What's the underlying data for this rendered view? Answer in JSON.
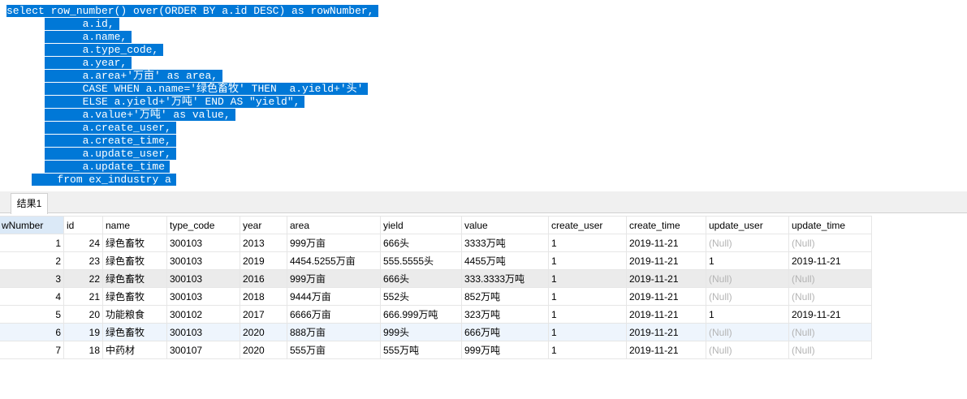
{
  "sql": [
    "select row_number() over(ORDER BY a.id DESC) as rowNumber,",
    "      a.id,",
    "      a.name,",
    "      a.type_code,",
    "      a.year,",
    "      a.area+'万亩' as area,",
    "      CASE WHEN a.name='绿色畜牧' THEN  a.yield+'头'",
    "      ELSE a.yield+'万吨' END AS \"yield\",",
    "      a.value+'万吨' as value,",
    "      a.create_user,",
    "      a.create_time,",
    "      a.update_user,",
    "      a.update_time",
    "    from ex_industry a"
  ],
  "tab": "结果1",
  "columns": [
    "wNumber",
    "id",
    "name",
    "type_code",
    "year",
    "area",
    "yield",
    "value",
    "create_user",
    "create_time",
    "update_user",
    "update_time"
  ],
  "rows": [
    [
      "1",
      "24",
      "绿色畜牧",
      "300103",
      "2013",
      "999万亩",
      "666头",
      "3333万吨",
      "1",
      "2019-11-21",
      "(Null)",
      "(Null)"
    ],
    [
      "2",
      "23",
      "绿色畜牧",
      "300103",
      "2019",
      "4454.5255万亩",
      "555.5555头",
      "4455万吨",
      "1",
      "2019-11-21",
      "1",
      "2019-11-21"
    ],
    [
      "3",
      "22",
      "绿色畜牧",
      "300103",
      "2016",
      "999万亩",
      "666头",
      "333.3333万吨",
      "1",
      "2019-11-21",
      "(Null)",
      "(Null)"
    ],
    [
      "4",
      "21",
      "绿色畜牧",
      "300103",
      "2018",
      "9444万亩",
      "552头",
      "852万吨",
      "1",
      "2019-11-21",
      "(Null)",
      "(Null)"
    ],
    [
      "5",
      "20",
      "功能粮食",
      "300102",
      "2017",
      "6666万亩",
      "666.999万吨",
      "323万吨",
      "1",
      "2019-11-21",
      "1",
      "2019-11-21"
    ],
    [
      "6",
      "19",
      "绿色畜牧",
      "300103",
      "2020",
      "888万亩",
      "999头",
      "666万吨",
      "1",
      "2019-11-21",
      "(Null)",
      "(Null)"
    ],
    [
      "7",
      "18",
      "中药材",
      "300107",
      "2020",
      "555万亩",
      "555万吨",
      "999万吨",
      "1",
      "2019-11-21",
      "(Null)",
      "(Null)"
    ]
  ]
}
